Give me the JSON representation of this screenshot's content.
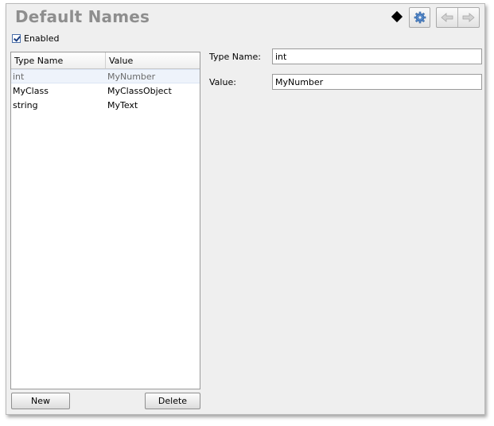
{
  "header": {
    "title": "Default Names"
  },
  "toolbar": {
    "settings_icon": "gear-icon",
    "back_icon": "arrow-left-icon",
    "forward_icon": "arrow-right-icon"
  },
  "enabled": {
    "label": "Enabled",
    "checked": true
  },
  "table": {
    "columns": [
      "Type Name",
      "Value"
    ],
    "rows": [
      {
        "type_name": "int",
        "value": "MyNumber",
        "selected": true
      },
      {
        "type_name": "MyClass",
        "value": "MyClassObject",
        "selected": false
      },
      {
        "type_name": "string",
        "value": "MyText",
        "selected": false
      }
    ]
  },
  "buttons": {
    "new_label": "New",
    "delete_label": "Delete"
  },
  "detail": {
    "type_name_label": "Type Name:",
    "type_name_value": "int",
    "value_label": "Value:",
    "value_value": "MyNumber"
  }
}
